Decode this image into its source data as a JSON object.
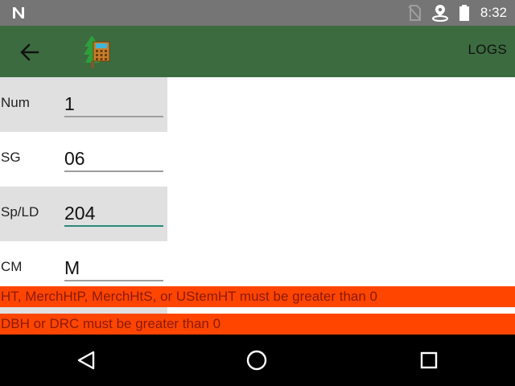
{
  "status_bar": {
    "time": "8:32",
    "icons": [
      "n-logo-icon",
      "no-sim-icon",
      "location-pin-icon",
      "battery-icon"
    ]
  },
  "toolbar": {
    "back_icon": "arrow-left-icon",
    "app_icon": "tree-calculator-icon",
    "logs_label": "LOGS"
  },
  "form": {
    "fields": [
      {
        "label": "Num",
        "value": "1"
      },
      {
        "label": "SG",
        "value": "06"
      },
      {
        "label": "Sp/LD",
        "value": "204"
      },
      {
        "label": "CM",
        "value": "M"
      }
    ]
  },
  "errors": [
    "HT, MerchHtP, MerchHtS, or UStemHT must be greater than 0",
    "DBH or DRC must be greater than 0"
  ],
  "colors": {
    "toolbar": "#3c6b3f",
    "status_bar": "#757575",
    "error_bg": "#ff4500",
    "error_text": "#8b1a00",
    "active_underline": "#2a8a7a"
  },
  "nav_bar": {
    "icons": [
      "nav-back-icon",
      "nav-home-icon",
      "nav-recents-icon"
    ]
  }
}
